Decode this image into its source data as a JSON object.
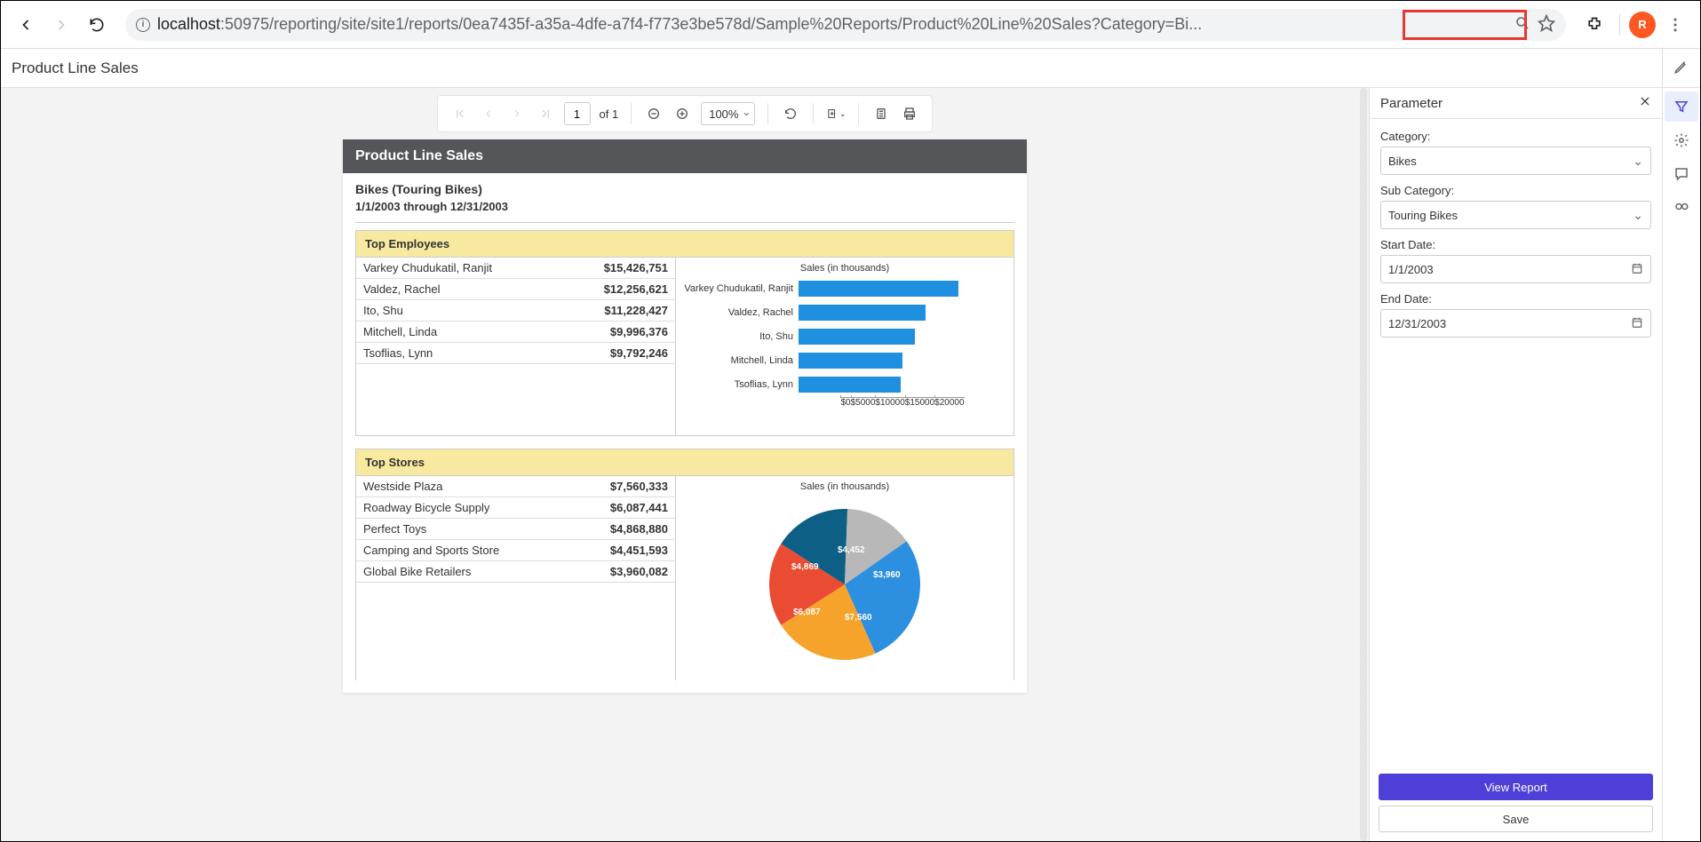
{
  "browser": {
    "url_host": "localhost",
    "url_path": ":50975/reporting/site/site1/reports/0ea7435f-a35a-4dfe-a7f4-f773e3be578d/Sample%20Reports/Product%20Line%20Sales?Category=Bi...",
    "avatar_letter": "R"
  },
  "page_title": "Product Line Sales",
  "toolbar": {
    "page_current": "1",
    "page_of": "of 1",
    "zoom": "100%"
  },
  "report": {
    "header": "Product Line Sales",
    "subcat": "Bikes (Touring Bikes)",
    "daterange": "1/1/2003 through 12/31/2003",
    "top_employees_title": "Top Employees",
    "top_stores_title": "Top Stores",
    "employees": [
      {
        "name": "Varkey Chudukatil, Ranjit",
        "value": "$15,426,751"
      },
      {
        "name": "Valdez, Rachel",
        "value": "$12,256,621"
      },
      {
        "name": "Ito, Shu",
        "value": "$11,228,427"
      },
      {
        "name": "Mitchell, Linda",
        "value": "$9,996,376"
      },
      {
        "name": "Tsoflias, Lynn",
        "value": "$9,792,246"
      }
    ],
    "stores": [
      {
        "name": "Westside Plaza",
        "value": "$7,560,333"
      },
      {
        "name": "Roadway Bicycle Supply",
        "value": "$6,087,441"
      },
      {
        "name": "Perfect Toys",
        "value": "$4,868,880"
      },
      {
        "name": "Camping and Sports Store",
        "value": "$4,451,593"
      },
      {
        "name": "Global Bike Retailers",
        "value": "$3,960,082"
      }
    ],
    "bar_chart_title": "Sales (in thousands)",
    "bar_axis": [
      "$0",
      "$5000",
      "$10000",
      "$15000",
      "$20000"
    ],
    "pie_chart_title": "Sales (in thousands)",
    "pie_labels": {
      "a": "$4,452",
      "b": "$3,960",
      "c": "$7,560",
      "d": "$6,087",
      "e": "$4,869"
    }
  },
  "parameters": {
    "panel_title": "Parameter",
    "category_label": "Category:",
    "category_value": "Bikes",
    "subcategory_label": "Sub Category:",
    "subcategory_value": "Touring Bikes",
    "start_label": "Start Date:",
    "start_value": "1/1/2003",
    "end_label": "End Date:",
    "end_value": "12/31/2003",
    "view_btn": "View Report",
    "save_btn": "Save"
  },
  "chart_data": [
    {
      "type": "bar",
      "title": "Sales (in thousands)",
      "orientation": "horizontal",
      "categories": [
        "Varkey Chudukatil, Ranjit",
        "Valdez, Rachel",
        "Ito, Shu",
        "Mitchell, Linda",
        "Tsoflias, Lynn"
      ],
      "values": [
        15426.751,
        12256.621,
        11228.427,
        9996.376,
        9792.246
      ],
      "xlabel": "",
      "ylabel": "",
      "xlim": [
        0,
        20000
      ],
      "ticks": [
        0,
        5000,
        10000,
        15000,
        20000
      ]
    },
    {
      "type": "pie",
      "title": "Sales (in thousands)",
      "categories": [
        "Westside Plaza",
        "Roadway Bicycle Supply",
        "Perfect Toys",
        "Camping and Sports Store",
        "Global Bike Retailers"
      ],
      "values": [
        7560.333,
        6087.441,
        4868.88,
        4451.593,
        3960.082
      ],
      "display_labels": [
        "$7,560",
        "$6,087",
        "$4,869",
        "$4,452",
        "$3,960"
      ]
    }
  ]
}
